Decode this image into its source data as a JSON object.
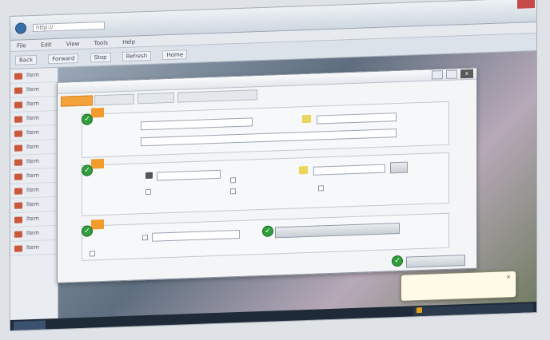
{
  "window": {
    "address": "http://"
  },
  "menu": [
    "File",
    "Edit",
    "View",
    "Tools",
    "Help"
  ],
  "toolbar": [
    "Back",
    "Forward",
    "Stop",
    "Refresh",
    "Home"
  ],
  "sidebar_items": [
    "Item",
    "Item",
    "Item",
    "Item",
    "Item",
    "Item",
    "Item",
    "Item",
    "Item",
    "Item",
    "Item",
    "Item",
    "Item"
  ],
  "dialog": {
    "title": "",
    "close_label": "x",
    "tabs": [
      "",
      "",
      "",
      ""
    ],
    "section1": {
      "label": "",
      "field1_label": "",
      "field1_value": "",
      "field2_label": "",
      "field2_value": "",
      "field3_label": "",
      "field3_value": ""
    },
    "section2": {
      "label": "",
      "field1_label": "",
      "field1_value": "",
      "field2_label": "",
      "field2_value": "",
      "field3_label": "",
      "check1_label": "",
      "check2_label": "",
      "check3_label": ""
    },
    "section3": {
      "label": "",
      "field_label": "",
      "field_value": "",
      "button_label": "",
      "link_text": ""
    },
    "ok_label": ""
  },
  "balloon": {
    "title": "",
    "text": ""
  },
  "tray": {
    "text": ""
  },
  "colors": {
    "accent_orange": "#f39c2e",
    "check_green": "#2f9e3b",
    "red_icon": "#c9583c"
  },
  "icons": [
    "check-icon",
    "warning-icon",
    "close-icon",
    "folder-icon",
    "key-icon"
  ]
}
